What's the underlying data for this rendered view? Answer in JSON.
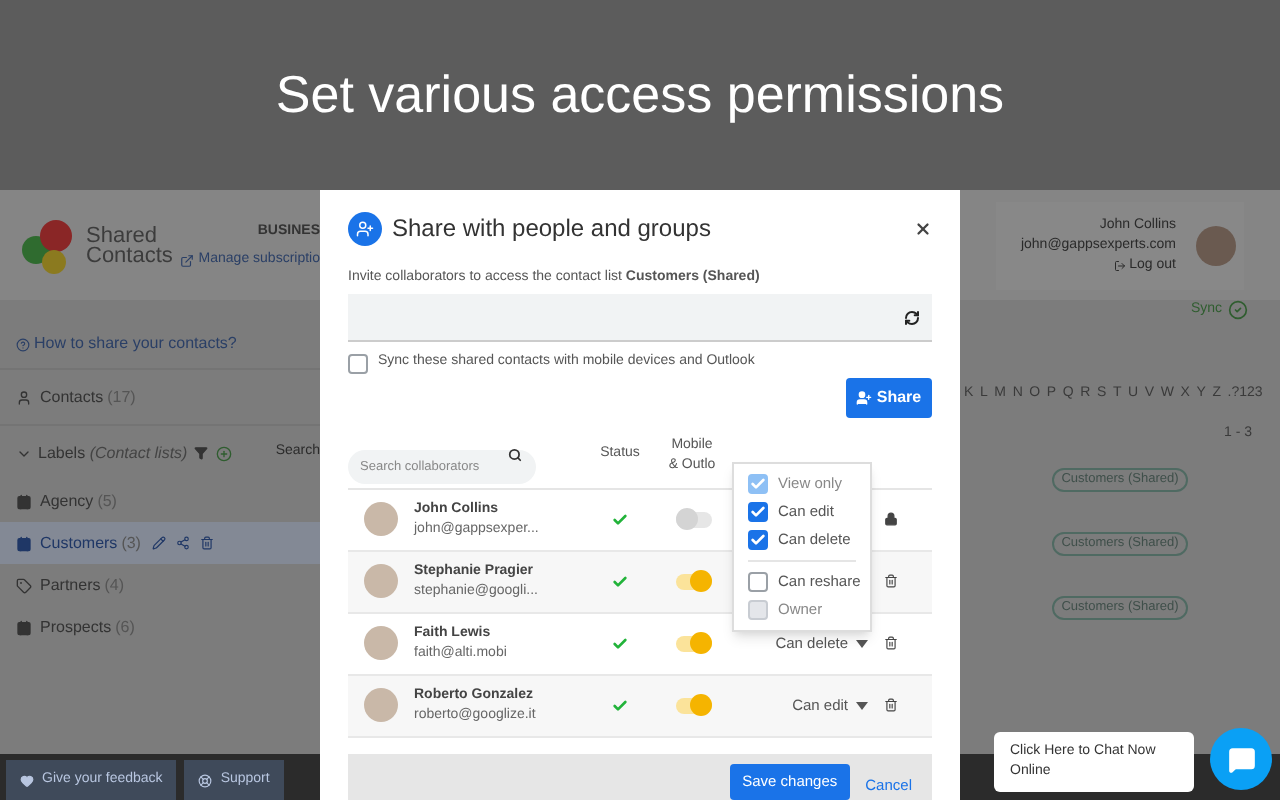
{
  "banner": {
    "title": "Set various access permissions"
  },
  "app": {
    "logo": {
      "line1": "Shared",
      "line2": "Contacts"
    },
    "plan": "BUSINES",
    "manage_link": "Manage subscriptio",
    "user": {
      "name": "John Collins",
      "email": "john@gappsexperts.com",
      "logout": "Log out"
    },
    "sync": "Sync",
    "help_link": "How to share your contacts?",
    "contacts": {
      "label": "Contacts",
      "count": "(17)"
    },
    "labels": {
      "label": "Labels",
      "hint": "(Contact lists)",
      "expanded": true
    },
    "search_hint": "Search",
    "label_items": [
      {
        "name": "Agency",
        "count": "(5)",
        "kind": "shared",
        "selected": false
      },
      {
        "name": "Customers",
        "count": "(3)",
        "kind": "shared",
        "selected": true
      },
      {
        "name": "Partners",
        "count": "(4)",
        "kind": "plain",
        "selected": false
      },
      {
        "name": "Prospects",
        "count": "(6)",
        "kind": "shared",
        "selected": false
      }
    ],
    "alphabet": [
      "K",
      "L",
      "M",
      "N",
      "O",
      "P",
      "Q",
      "R",
      "S",
      "T",
      "U",
      "V",
      "W",
      "X",
      "Y",
      "Z",
      ".?123"
    ],
    "pagination": "1 - 3",
    "row_tags": [
      "Customers (Shared)",
      "Customers (Shared)",
      "Customers (Shared)"
    ],
    "footer_buttons": [
      {
        "label": "Give your feedback",
        "kind": "feedback"
      },
      {
        "label": "Support",
        "kind": "support"
      }
    ]
  },
  "dialog": {
    "title": "Share with people and groups",
    "subtitle": "Invite collaborators to access the contact list **Customers (Shared)**",
    "sync_option": {
      "label": "Sync these shared contacts with mobile devices and Outlook",
      "checked": false
    },
    "share_button": "Share",
    "search": {
      "placeholder": "Search collaborators"
    },
    "columns": {
      "status": "Status",
      "mobile": [
        "Mobile",
        "& Outlo"
      ]
    },
    "rows": [
      {
        "name": "John Collins",
        "email": "john@gappsexper...",
        "active": true,
        "sync": false,
        "kind": "lock"
      },
      {
        "name": "Stephanie Pragier",
        "email": "stephanie@googli...",
        "active": true,
        "sync": true,
        "kind": "delete"
      },
      {
        "name": "Faith Lewis",
        "email": "faith@alti.mobi",
        "active": true,
        "sync": true,
        "permission": "Can delete",
        "kind": "delete"
      },
      {
        "name": "Roberto Gonzalez",
        "email": "roberto@googlize.it",
        "active": true,
        "sync": true,
        "permission": "Can edit",
        "kind": "delete"
      }
    ],
    "permission_menu": [
      [
        {
          "label": "View only",
          "checked": true,
          "disabled": true
        },
        {
          "label": "Can edit",
          "checked": true,
          "disabled": false
        },
        {
          "label": "Can delete",
          "checked": true,
          "disabled": false
        }
      ],
      [
        {
          "label": "Can reshare",
          "checked": false,
          "disabled": false
        },
        {
          "label": "Owner",
          "checked": false,
          "disabled": true
        }
      ]
    ],
    "save_button": "Save changes",
    "cancel_link": "Cancel"
  },
  "chat": {
    "message": "Click Here to Chat Now Online"
  }
}
